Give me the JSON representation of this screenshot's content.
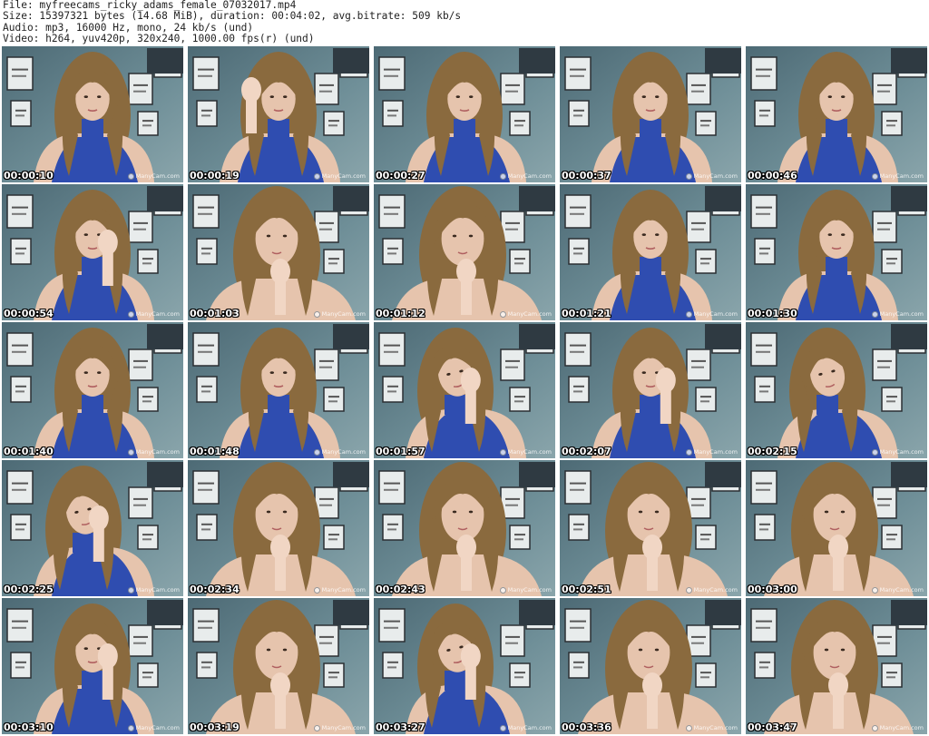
{
  "header": {
    "file_line": "File: myfreecams_ricky_adams_female_07032017.mp4",
    "size_line": "Size: 15397321 bytes (14.68 MiB), duration: 00:04:02, avg.bitrate: 509 kb/s",
    "audio_line": "Audio: mp3, 16000 Hz, mono, 24 kb/s (und)",
    "video_line": "Video: h264, yuv420p, 320x240, 1000.00 fps(r) (und)"
  },
  "watermark_text": "ManyCam.com",
  "colors": {
    "wall": "#6f8f98",
    "sweater": "#2f4db0",
    "hair": "#8a6a3e",
    "skin": "#e6c4ad"
  },
  "frames": [
    {
      "timestamp": "00:00:10",
      "pose": "center"
    },
    {
      "timestamp": "00:00:19",
      "pose": "hand-head"
    },
    {
      "timestamp": "00:00:27",
      "pose": "center"
    },
    {
      "timestamp": "00:00:37",
      "pose": "center"
    },
    {
      "timestamp": "00:00:46",
      "pose": "center"
    },
    {
      "timestamp": "00:00:54",
      "pose": "hand-face"
    },
    {
      "timestamp": "00:01:03",
      "pose": "close-hand-chin"
    },
    {
      "timestamp": "00:01:12",
      "pose": "close-hand-chin"
    },
    {
      "timestamp": "00:01:21",
      "pose": "center"
    },
    {
      "timestamp": "00:01:30",
      "pose": "center"
    },
    {
      "timestamp": "00:01:40",
      "pose": "center"
    },
    {
      "timestamp": "00:01:48",
      "pose": "center"
    },
    {
      "timestamp": "00:01:57",
      "pose": "tilt-hand"
    },
    {
      "timestamp": "00:02:07",
      "pose": "hand-face"
    },
    {
      "timestamp": "00:02:15",
      "pose": "tilt"
    },
    {
      "timestamp": "00:02:25",
      "pose": "tilt-hand"
    },
    {
      "timestamp": "00:02:34",
      "pose": "close-hand-chin"
    },
    {
      "timestamp": "00:02:43",
      "pose": "close-hand-chin"
    },
    {
      "timestamp": "00:02:51",
      "pose": "close-hand-chin"
    },
    {
      "timestamp": "00:03:00",
      "pose": "close-hand-chin"
    },
    {
      "timestamp": "00:03:10",
      "pose": "hand-face"
    },
    {
      "timestamp": "00:03:19",
      "pose": "close-hand-chin"
    },
    {
      "timestamp": "00:03:27",
      "pose": "tilt-hand"
    },
    {
      "timestamp": "00:03:36",
      "pose": "close-hand-chin"
    },
    {
      "timestamp": "00:03:47",
      "pose": "close-hand-chin"
    }
  ]
}
